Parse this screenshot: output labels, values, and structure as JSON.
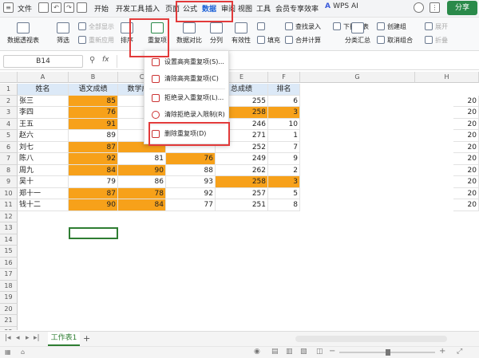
{
  "menubar": {
    "file": "文件",
    "items": [
      "开始",
      "开发工具",
      "插入",
      "页面",
      "公式",
      "数据",
      "审阅",
      "视图",
      "工具",
      "会员专享",
      "效率"
    ],
    "active_index": 5,
    "wps_ai": "WPS AI",
    "share": "分享"
  },
  "ribbon": {
    "pivot": "数据透视表",
    "filter": "筛选",
    "show_all": "全部显示",
    "reapply": "重新应用",
    "sort": "排序",
    "duplicates": "重复项",
    "compare": "数据对比",
    "split": "分列",
    "validity": "有效性",
    "fill": "填充",
    "lookup": "查找录入",
    "merge_calc": "合并计算",
    "dropdown_list": "下拉列表",
    "subtotal": "分类汇总",
    "create_group": "创建组",
    "ungroup": "取消组合",
    "expand": "展开",
    "collapse": "折叠"
  },
  "formula_bar": {
    "name_box": "B14",
    "fx": "fx"
  },
  "columns": [
    "A",
    "B",
    "C",
    "D",
    "E",
    "F",
    "G",
    "H"
  ],
  "rows": [
    "1",
    "2",
    "3",
    "4",
    "5",
    "6",
    "7",
    "8",
    "9",
    "10",
    "11",
    "12",
    "13",
    "14",
    "15",
    "16",
    "17",
    "18",
    "19",
    "20",
    "21",
    "22"
  ],
  "table": {
    "headers": [
      "姓名",
      "语文成绩",
      "数学成绩",
      "英语成绩",
      "总成绩",
      "排名"
    ],
    "records": [
      {
        "name": "张三",
        "b": "85",
        "c": "",
        "d": "",
        "e": "255",
        "f": "6"
      },
      {
        "name": "李四",
        "b": "76",
        "c": "",
        "d": "",
        "e": "258",
        "f": "3"
      },
      {
        "name": "王五",
        "b": "91",
        "c": "",
        "d": "",
        "e": "246",
        "f": "10"
      },
      {
        "name": "赵六",
        "b": "89",
        "c": "",
        "d": "",
        "e": "271",
        "f": "1"
      },
      {
        "name": "刘七",
        "b": "87",
        "c": "",
        "d": "",
        "e": "252",
        "f": "7"
      },
      {
        "name": "陈八",
        "b": "92",
        "c": "81",
        "d": "76",
        "e": "249",
        "f": "9"
      },
      {
        "name": "周九",
        "b": "84",
        "c": "90",
        "d": "88",
        "e": "262",
        "f": "2"
      },
      {
        "name": "吴十",
        "b": "79",
        "c": "86",
        "d": "93",
        "e": "258",
        "f": "3"
      },
      {
        "name": "郑十一",
        "b": "87",
        "c": "78",
        "d": "92",
        "e": "257",
        "f": "5"
      },
      {
        "name": "钱十二",
        "b": "90",
        "c": "84",
        "d": "77",
        "e": "251",
        "f": "8"
      }
    ],
    "h_values": [
      "20",
      "20",
      "20",
      "20",
      "20",
      "20",
      "20",
      "20",
      "20",
      "20"
    ]
  },
  "dropdown": {
    "items": [
      "设置高亮重复项(S)...",
      "清除高亮重复项(C)",
      "拒绝录入重复项(L)...",
      "清除拒绝录入限制(R)",
      "删除重复项(D)"
    ]
  },
  "sheet_tab": "工作表1",
  "add_sheet": "+",
  "colors": {
    "highlight": "#f7a11a",
    "header_bg": "#dce9f7",
    "accent": "#1a5fd6",
    "annotation": "#e23a3a",
    "share_bg": "#2a8a4a"
  }
}
